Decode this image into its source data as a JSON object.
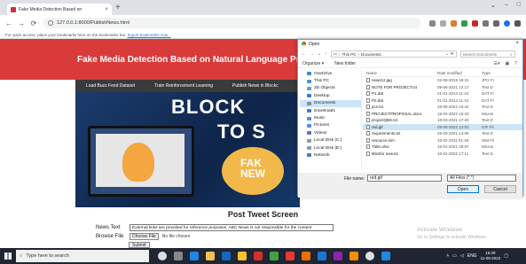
{
  "browser": {
    "tab_title": "Fake Media Detection Based on",
    "tab_close": "×",
    "new_tab": "+",
    "window_controls": [
      "⌄",
      "–",
      "□"
    ],
    "url": "127.0.0.1:8000/PublishNews.html",
    "bookmarks_bar_text": "For quick access, place your bookmarks here on the bookmarks bar.",
    "bookmarks_link": "Import bookmarks now..."
  },
  "page": {
    "hero_title": "Fake Media Detection Based on Natural Language Processing",
    "nav_links": [
      "Load Buzz Feed Dataset",
      "Train Reinforcement Learning",
      "Publish News in Blockc"
    ],
    "banner_line1": "BLOCK",
    "banner_line2": "TO S",
    "banner_fake": "FAK\nNEW",
    "form_title": "Post Tweet Screen",
    "news_label": "News Text",
    "news_value": "External links are provided for reference purposes. ABC News is not responsible for the content",
    "file_label": "Browse File",
    "file_button": "Choose File",
    "file_none": "No file chosen",
    "submit_label": "Submit"
  },
  "watermark": {
    "line1": "Activate Windows",
    "line2": "Go to Settings to activate Windows."
  },
  "dialog": {
    "title": "Open",
    "close": "×",
    "path": [
      "This PC",
      "Documents"
    ],
    "search_placeholder": "Search Documents",
    "organize": "Organize ▾",
    "new_folder": "New folder",
    "sidebar": [
      {
        "label": "OneDrive",
        "color": "#3b8ad9"
      },
      {
        "label": "This PC",
        "color": "#4a90d9"
      },
      {
        "label": "3D Objects",
        "color": "#5aa0e0"
      },
      {
        "label": "Desktop",
        "color": "#3a7bd5"
      },
      {
        "label": "Documents",
        "color": "#7a8ca5",
        "selected": true
      },
      {
        "label": "Downloads",
        "color": "#3d7bd6"
      },
      {
        "label": "Music",
        "color": "#4f8fe0"
      },
      {
        "label": "Pictures",
        "color": "#4d8fe2"
      },
      {
        "label": "Videos",
        "color": "#5b6cd5"
      },
      {
        "label": "Local Disk (C:)",
        "color": "#8a9aa8"
      },
      {
        "label": "Local Disk (E:)",
        "color": "#8a9aa8"
      },
      {
        "label": "Network",
        "color": "#4a78c2"
      }
    ],
    "columns": {
      "name": "Name",
      "date": "Date modified",
      "type": "Type"
    },
    "files": [
      {
        "name": "news12.jpg",
        "date": "02-08-2019 19:31",
        "type": "JPG Fi"
      },
      {
        "name": "NOTE FOR PROJECT.txt",
        "date": "09-06-2021 12:17",
        "type": "Text D"
      },
      {
        "name": "P1.dat",
        "date": "21-01-2014 11:24",
        "type": "DAT Fi"
      },
      {
        "name": "P2.dat",
        "date": "21-01-2014 11:24",
        "type": "DAT Fi"
      },
      {
        "name": "pcs.txt",
        "date": "28-05-2022 16:42",
        "type": "Text D"
      },
      {
        "name": "PROJECTPROPOSAL.docx",
        "date": "15-04-2022 16:23",
        "type": "Micros"
      },
      {
        "name": "projectQBS.txt",
        "date": "18-03-2021 17:20",
        "type": "Text D"
      },
      {
        "name": "red.gif",
        "date": "09-08-2022 12:53",
        "type": "GIF Fil",
        "selected": true
      },
      {
        "name": "requirements.txt",
        "date": "25-03-2021 14:06",
        "type": "Text D"
      },
      {
        "name": "resource.sim",
        "date": "15-02-2011 01:48",
        "type": "SIM Fil"
      },
      {
        "name": "Titles.xlsx",
        "date": "15-01-2021 08:57",
        "type": "Micros"
      },
      {
        "name": "titlesfor new.txt",
        "date": "15-02-2022 17:11",
        "type": "Text D"
      }
    ],
    "file_name_label": "File name:",
    "file_name_value": "red.gif",
    "file_type": "All Files (*.*)",
    "open_label": "Open",
    "cancel_label": "Cancel"
  },
  "taskbar": {
    "search_placeholder": "Type here to search",
    "clock_time": "16:29",
    "clock_date": "11-08-2022",
    "lang": "ENG"
  },
  "colors": {
    "hero": "#d93a3a",
    "navbar": "#3a3a3a",
    "taskbar": "#1f2533",
    "selection": "#cce4f7"
  }
}
